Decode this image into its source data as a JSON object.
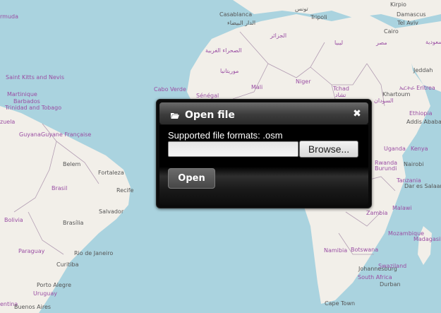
{
  "map": {
    "colors": {
      "water": "#aad3df",
      "land": "#f2efe9",
      "border": "#b39db3"
    },
    "labels": [
      {
        "id": "casablanca",
        "text": "Casablanca",
        "kind": "city"
      },
      {
        "id": "casablanca_ar",
        "text": "الدار البيضاء",
        "kind": "city"
      },
      {
        "id": "tunis",
        "text": "تونس",
        "kind": "city"
      },
      {
        "id": "tripoli",
        "text": "Tripoli",
        "kind": "city"
      },
      {
        "id": "kinshasa_top",
        "text": "Kirpio",
        "kind": "city"
      },
      {
        "id": "damascus",
        "text": "Damascus",
        "kind": "city"
      },
      {
        "id": "tel_aviv",
        "text": "Tel Aviv",
        "kind": "city"
      },
      {
        "id": "cairo",
        "text": "Cairo",
        "kind": "city"
      },
      {
        "id": "misr",
        "text": "مصر",
        "kind": "country"
      },
      {
        "id": "algeria",
        "text": "الجزائر",
        "kind": "country"
      },
      {
        "id": "libya",
        "text": "ليبيا",
        "kind": "country"
      },
      {
        "id": "sahara",
        "text": "الصحراء الغربية",
        "kind": "country"
      },
      {
        "id": "mauritania",
        "text": "موريتانيا",
        "kind": "country"
      },
      {
        "id": "cabo_verde",
        "text": "Cabo Verde",
        "kind": "country"
      },
      {
        "id": "mali",
        "text": "Mali",
        "kind": "country"
      },
      {
        "id": "niger",
        "text": "Niger",
        "kind": "country"
      },
      {
        "id": "tchad",
        "text": "Tchad",
        "kind": "country"
      },
      {
        "id": "tchad_ar",
        "text": "تشاد",
        "kind": "country"
      },
      {
        "id": "senegal",
        "text": "Sénégal",
        "kind": "country"
      },
      {
        "id": "sudan",
        "text": "السودان",
        "kind": "country"
      },
      {
        "id": "khartoum",
        "text": "Khartoum",
        "kind": "city"
      },
      {
        "id": "jeddah",
        "text": "Jeddah",
        "kind": "city"
      },
      {
        "id": "eritrea",
        "text": "ኤርትራ Eritrea",
        "kind": "country"
      },
      {
        "id": "ethiopia",
        "text": "Ethiopia",
        "kind": "country"
      },
      {
        "id": "addis",
        "text": "Addis Ababa",
        "kind": "city"
      },
      {
        "id": "saudi",
        "text": "السعودية",
        "kind": "country"
      },
      {
        "id": "uganda",
        "text": "Uganda",
        "kind": "country"
      },
      {
        "id": "kenya",
        "text": "Kenya",
        "kind": "country"
      },
      {
        "id": "rwanda",
        "text": "Rwanda",
        "kind": "country"
      },
      {
        "id": "burundi",
        "text": "Burundi",
        "kind": "country"
      },
      {
        "id": "nairobi",
        "text": "Nairobi",
        "kind": "city"
      },
      {
        "id": "tanzania",
        "text": "Tanzania",
        "kind": "country"
      },
      {
        "id": "dar",
        "text": "Dar es Salaam",
        "kind": "city"
      },
      {
        "id": "zambia",
        "text": "Zambia",
        "kind": "country"
      },
      {
        "id": "malawi",
        "text": "Malawi",
        "kind": "country"
      },
      {
        "id": "mozambique",
        "text": "Mozambique",
        "kind": "country"
      },
      {
        "id": "madagasikara",
        "text": "Madagasikara",
        "kind": "country"
      },
      {
        "id": "namibia",
        "text": "Namibia",
        "kind": "country"
      },
      {
        "id": "botswana",
        "text": "Botswana",
        "kind": "country"
      },
      {
        "id": "south_africa",
        "text": "South Africa",
        "kind": "country"
      },
      {
        "id": "johannesburg",
        "text": "Johannesburg",
        "kind": "city"
      },
      {
        "id": "swaziland",
        "text": "Swaziland",
        "kind": "country"
      },
      {
        "id": "durban",
        "text": "Durban",
        "kind": "city"
      },
      {
        "id": "cape_town",
        "text": "Cape Town",
        "kind": "city"
      },
      {
        "id": "bermuda",
        "text": "rmuda",
        "kind": "country"
      },
      {
        "id": "saint_kitts",
        "text": "Saint Kitts and Nevis",
        "kind": "country"
      },
      {
        "id": "martinique",
        "text": "Martinique",
        "kind": "country"
      },
      {
        "id": "barbados",
        "text": "Barbados",
        "kind": "country"
      },
      {
        "id": "trinidad",
        "text": "Trinidad and Tobago",
        "kind": "country"
      },
      {
        "id": "venezuela",
        "text": "zuela",
        "kind": "country"
      },
      {
        "id": "guyana",
        "text": "Guyana",
        "kind": "country"
      },
      {
        "id": "guyane",
        "text": "Guyane Française",
        "kind": "country"
      },
      {
        "id": "belem",
        "text": "Belem",
        "kind": "city"
      },
      {
        "id": "fortaleza",
        "text": "Fortaleza",
        "kind": "city"
      },
      {
        "id": "brasil",
        "text": "Brasil",
        "kind": "country"
      },
      {
        "id": "recife",
        "text": "Recife",
        "kind": "city"
      },
      {
        "id": "salvador",
        "text": "Salvador",
        "kind": "city"
      },
      {
        "id": "bolivia",
        "text": "Bolivia",
        "kind": "country"
      },
      {
        "id": "brasilia",
        "text": "Brasília",
        "kind": "city"
      },
      {
        "id": "paraguay",
        "text": "Paraguay",
        "kind": "country"
      },
      {
        "id": "rio",
        "text": "Rio de Janeiro",
        "kind": "city"
      },
      {
        "id": "curitiba",
        "text": "Curitiba",
        "kind": "city"
      },
      {
        "id": "porto_alegre",
        "text": "Porto Alegre",
        "kind": "city"
      },
      {
        "id": "uruguay",
        "text": "Uruguay",
        "kind": "country"
      },
      {
        "id": "argentina",
        "text": "entina",
        "kind": "country"
      },
      {
        "id": "buenos",
        "text": "Buenos Aires",
        "kind": "city"
      }
    ]
  },
  "dialog": {
    "title": "Open file",
    "title_icon": "folder-open-icon",
    "close_icon": "close-icon",
    "formats_text": "Supported file formats: .osm",
    "file_input_value": "",
    "browse_label": "Browse...",
    "open_label": "Open"
  }
}
